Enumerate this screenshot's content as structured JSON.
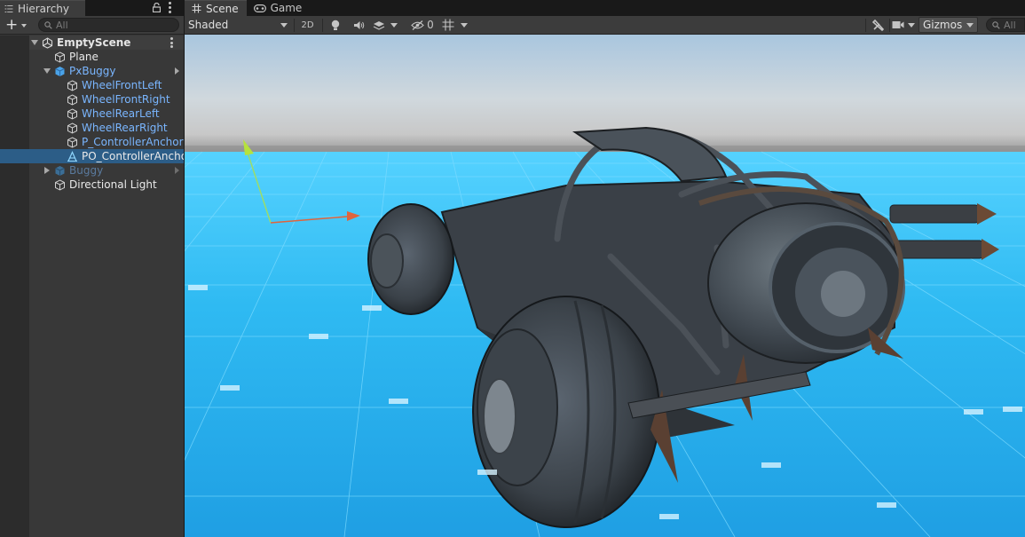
{
  "hierarchy": {
    "tab_label": "Hierarchy",
    "search_placeholder": "All",
    "items": [
      {
        "label": "EmptyScene"
      },
      {
        "label": "Plane"
      },
      {
        "label": "PxBuggy"
      },
      {
        "label": "WheelFrontLeft"
      },
      {
        "label": "WheelFrontRight"
      },
      {
        "label": "WheelRearLeft"
      },
      {
        "label": "WheelRearRight"
      },
      {
        "label": "P_ControllerAnchor"
      },
      {
        "label": "PO_ControllerAncho"
      },
      {
        "label": "Buggy"
      },
      {
        "label": "Directional Light"
      }
    ]
  },
  "scene": {
    "tabs": [
      {
        "label": "Scene",
        "icon": "grid-icon"
      },
      {
        "label": "Game",
        "icon": "gamepad-icon"
      }
    ],
    "shading_mode": "Shaded",
    "toggle_2d": "2D",
    "hidden_count": "0",
    "gizmos_label": "Gizmos",
    "search_placeholder": "All"
  },
  "colors": {
    "selection": "#2c5d87",
    "prefab_text": "#7ab6ff",
    "ground": "#29b3ef",
    "sky_top": "#b8cfe0"
  }
}
